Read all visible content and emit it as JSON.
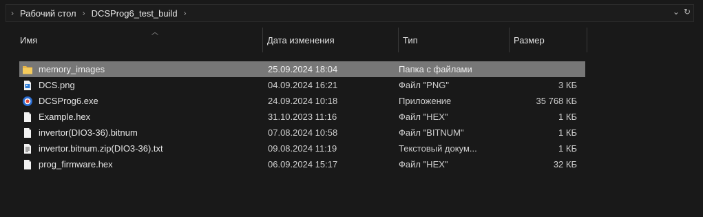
{
  "address": {
    "crumbs": [
      "Рабочий стол",
      "DCSProg6_test_build"
    ],
    "sep": "›"
  },
  "columns": {
    "name": "Имя",
    "date": "Дата изменения",
    "type": "Тип",
    "size": "Размер"
  },
  "files": [
    {
      "name": "memory_images",
      "date": "25.09.2024 18:04",
      "type": "Папка с файлами",
      "size": "",
      "icon": "folder-icon",
      "selected": true
    },
    {
      "name": "DCS.png",
      "date": "04.09.2024 16:21",
      "type": "Файл \"PNG\"",
      "size": "3 КБ",
      "icon": "image-file-icon"
    },
    {
      "name": "DCSProg6.exe",
      "date": "24.09.2024 10:18",
      "type": "Приложение",
      "size": "35 768 КБ",
      "icon": "app-icon"
    },
    {
      "name": "Example.hex",
      "date": "31.10.2023 11:16",
      "type": "Файл \"HEX\"",
      "size": "1 КБ",
      "icon": "file-icon"
    },
    {
      "name": "invertor(DIO3-36).bitnum",
      "date": "07.08.2024 10:58",
      "type": "Файл \"BITNUM\"",
      "size": "1 КБ",
      "icon": "file-icon"
    },
    {
      "name": "invertor.bitnum.zip(DIO3-36).txt",
      "date": "09.08.2024 11:19",
      "type": "Текстовый докум...",
      "size": "1 КБ",
      "icon": "text-file-icon"
    },
    {
      "name": "prog_firmware.hex",
      "date": "06.09.2024 15:17",
      "type": "Файл \"HEX\"",
      "size": "32 КБ",
      "icon": "file-icon"
    }
  ]
}
